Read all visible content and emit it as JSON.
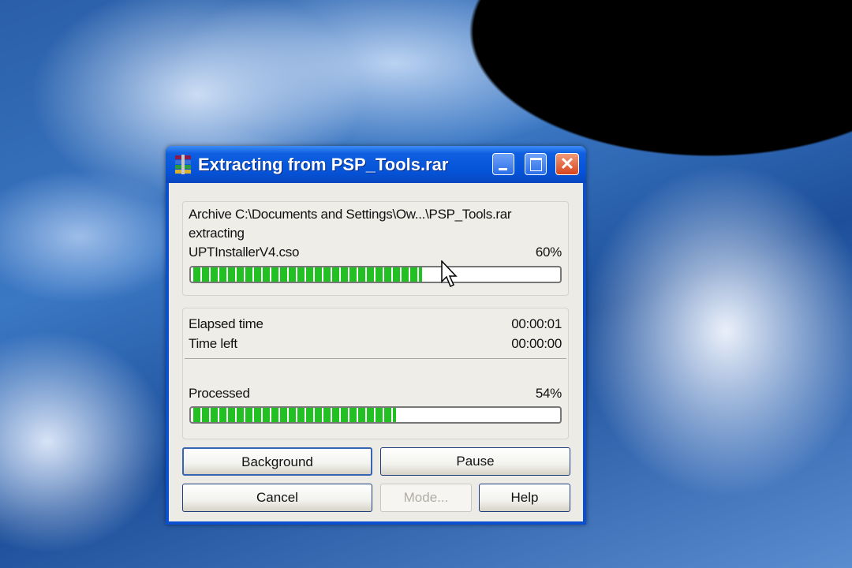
{
  "window": {
    "title": "Extracting from PSP_Tools.rar"
  },
  "archive": {
    "line": "Archive C:\\Documents and Settings\\Ow...\\PSP_Tools.rar",
    "action": "extracting",
    "current_file": "UPTInstallerV4.cso",
    "file_percent_label": "60%",
    "file_progress": 0.62
  },
  "times": {
    "elapsed_label": "Elapsed time",
    "elapsed_value": "00:00:01",
    "left_label": "Time left",
    "left_value": "00:00:00"
  },
  "processed": {
    "label": "Processed",
    "percent_label": "54%",
    "progress": 0.55
  },
  "buttons": {
    "background": "Background",
    "pause": "Pause",
    "cancel": "Cancel",
    "mode": "Mode...",
    "help": "Help"
  },
  "colors": {
    "progress": "#22c022",
    "titlebar": "#0553d8"
  }
}
